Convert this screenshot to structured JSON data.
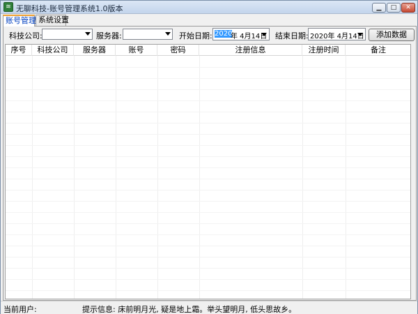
{
  "window": {
    "title": "无聊科技-账号管理系统1.0版本",
    "icon": "app-logo-icon"
  },
  "tabs": [
    {
      "label": "账号管理",
      "active": true
    },
    {
      "label": "系统设置",
      "active": false
    }
  ],
  "filters": {
    "company_label": "科技公司:",
    "company_value": "",
    "server_label": "服务器:",
    "server_value": "",
    "start_date_label": "开始日期:",
    "start_date_year": "2020",
    "start_date_rest": "年  4月14日",
    "end_date_label": "结束日期:",
    "end_date_value": "2020年  4月14日",
    "add_button": "添加数据"
  },
  "table": {
    "columns": [
      "序号",
      "科技公司",
      "服务器",
      "账号",
      "密码",
      "注册信息",
      "注册时间",
      "备注"
    ],
    "rows": []
  },
  "status": {
    "current_user_label": "当前用户:",
    "tip_text": "提示信息: 床前明月光, 疑是地上霜。举头望明月, 低头思故乡。"
  },
  "colors": {
    "title_bar": "#c3d5ec",
    "active_tab_text": "#0040c0",
    "selection": "#3399ff"
  }
}
